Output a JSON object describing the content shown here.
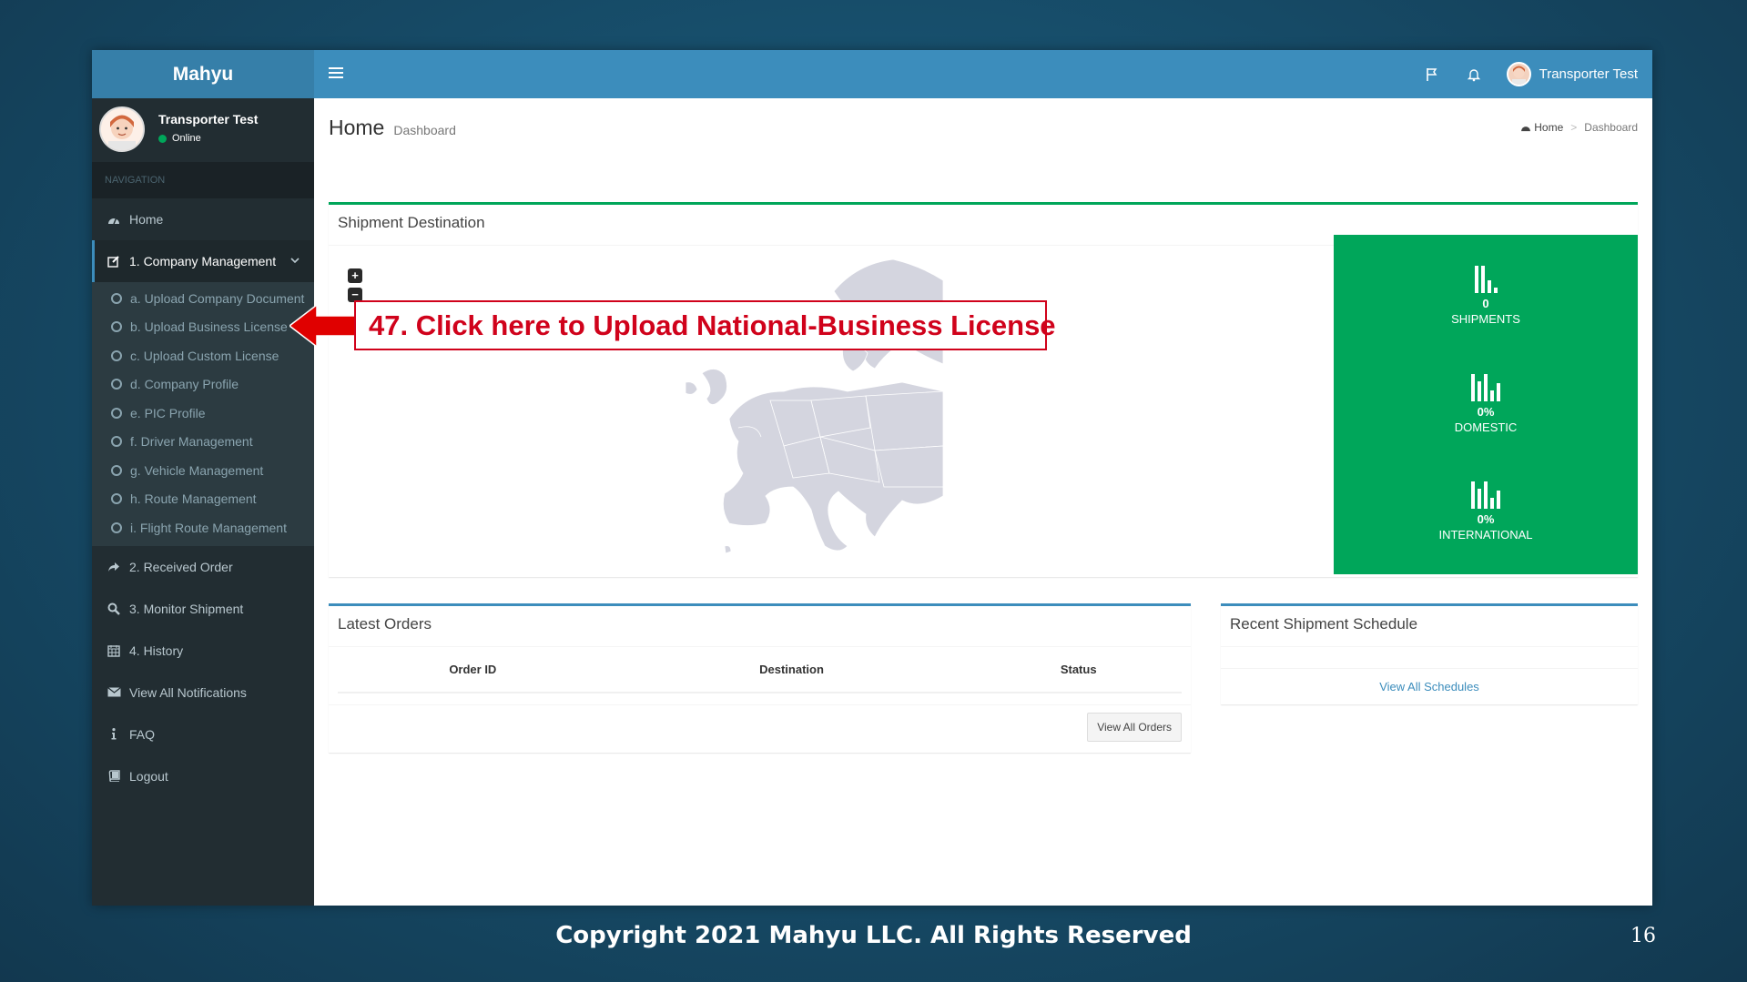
{
  "app": {
    "logo": "Mahyu"
  },
  "header": {
    "user_name": "Transporter Test"
  },
  "sidebar": {
    "user": {
      "name": "Transporter Test",
      "status": "Online"
    },
    "nav_header": "NAVIGATION",
    "home": "Home",
    "company_management": "1. Company Management",
    "sub_items": [
      "a. Upload Company Document",
      "b. Upload Business License",
      "c. Upload Custom License",
      "d. Company Profile",
      "e. PIC Profile",
      "f. Driver Management",
      "g. Vehicle Management",
      "h. Route Management",
      "i. Flight Route Management"
    ],
    "received_order": "2. Received Order",
    "monitor_shipment": "3. Monitor Shipment",
    "history": "4. History",
    "notifications": "View All Notifications",
    "faq": "FAQ",
    "logout": "Logout"
  },
  "page": {
    "title": "Home",
    "subtitle": "Dashboard",
    "breadcrumb": {
      "home": "Home",
      "sep": ">",
      "current": "Dashboard"
    }
  },
  "map_box": {
    "title": "Shipment Destination",
    "zoom_in": "+",
    "zoom_out": "−"
  },
  "stats": [
    {
      "value": "0",
      "label": "SHIPMENTS"
    },
    {
      "value": "0%",
      "label": "DOMESTIC"
    },
    {
      "value": "0%",
      "label": "INTERNATIONAL"
    }
  ],
  "latest_orders": {
    "title": "Latest Orders",
    "columns": [
      "Order ID",
      "Destination",
      "Status"
    ],
    "button": "View All Orders"
  },
  "schedule": {
    "title": "Recent Shipment Schedule",
    "link": "View All Schedules"
  },
  "callout": {
    "text": "47. Click here to Upload National-Business License"
  },
  "slide": {
    "footer": "Copyright 2021 Mahyu LLC. All Rights Reserved",
    "page_number": "16"
  },
  "colors": {
    "header": "#3c8dbc",
    "logo": "#367fa9",
    "sidebar": "#222d32",
    "stats": "#00a65a",
    "callout": "#d0021b"
  }
}
